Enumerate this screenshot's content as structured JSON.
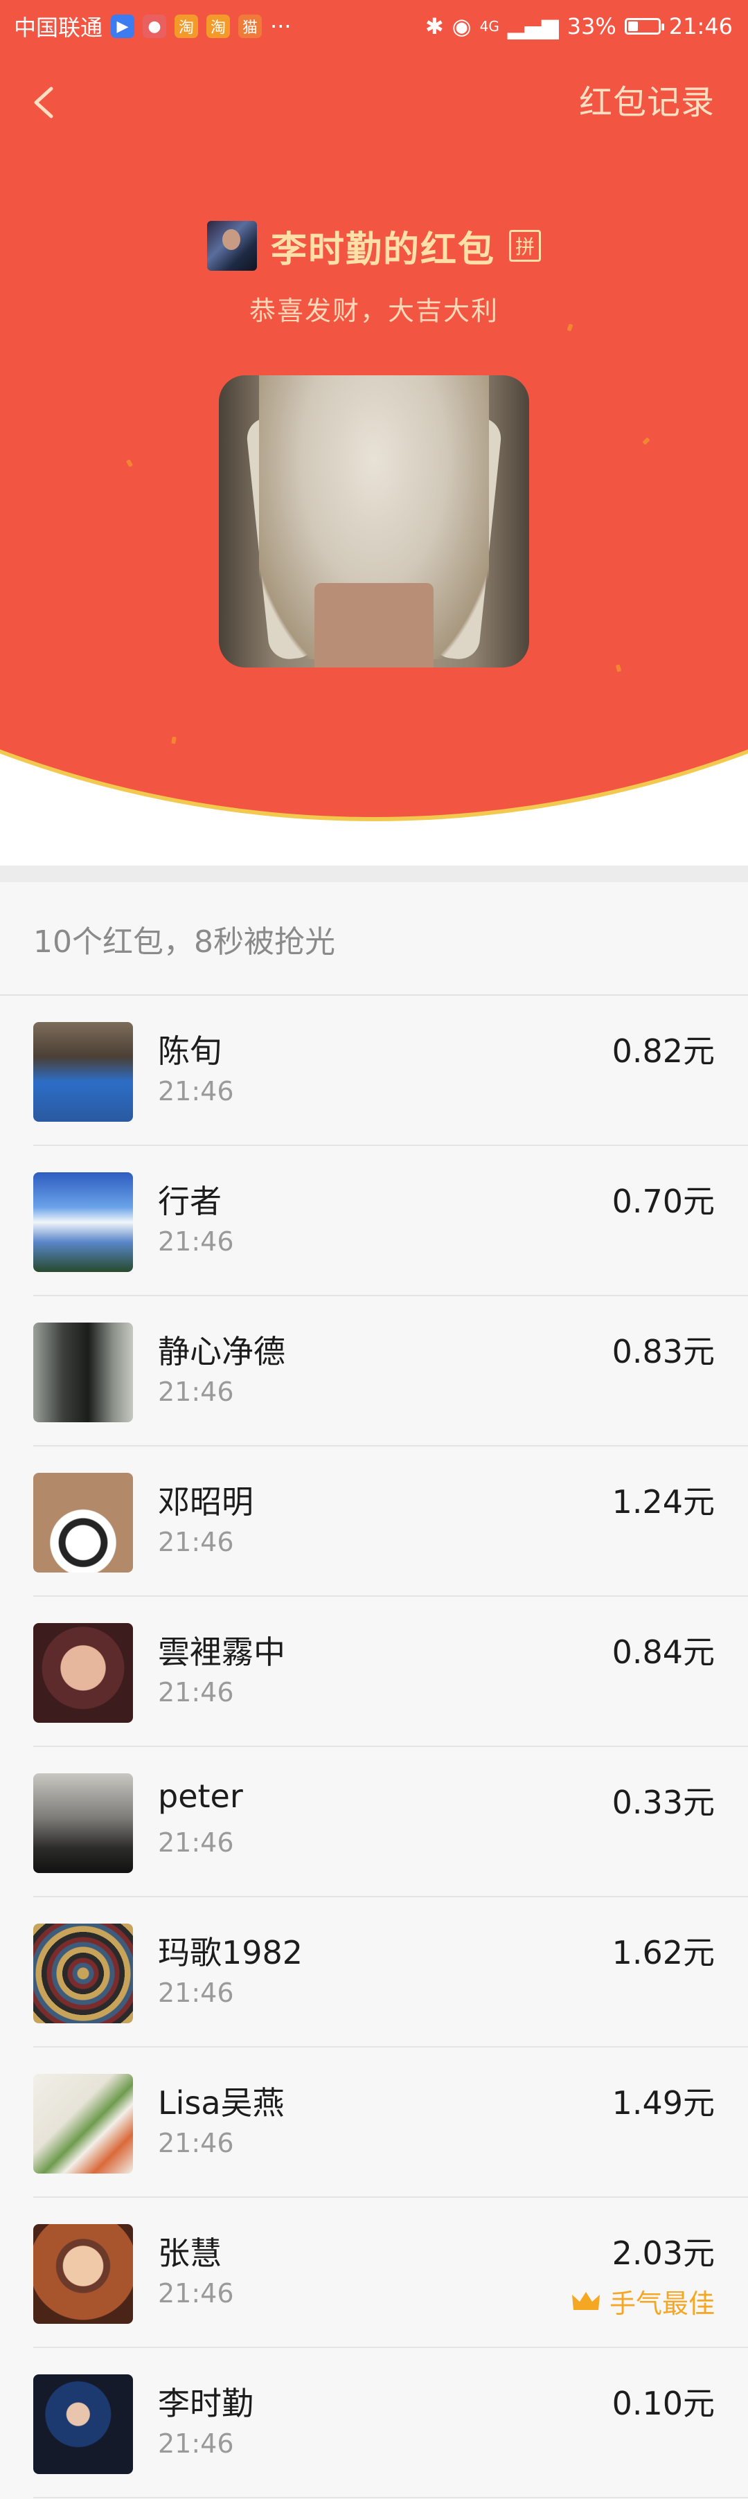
{
  "status_bar": {
    "carrier": "中国联通",
    "more": "···",
    "network": "4G",
    "battery": "33%",
    "time": "21:46"
  },
  "header": {
    "records_link": "红包记录",
    "sender_title": "李时勤的红包",
    "pin_badge": "拼",
    "greeting": "恭喜发财，大吉大利"
  },
  "summary": "10个红包，8秒被抢光",
  "list": [
    {
      "name": "陈旬",
      "time": "21:46",
      "amount": "0.82元"
    },
    {
      "name": "行者",
      "time": "21:46",
      "amount": "0.70元"
    },
    {
      "name": "静心净德",
      "time": "21:46",
      "amount": "0.83元"
    },
    {
      "name": "邓昭明",
      "time": "21:46",
      "amount": "1.24元"
    },
    {
      "name": "雲裡霧中",
      "time": "21:46",
      "amount": "0.84元"
    },
    {
      "name": "peter",
      "time": "21:46",
      "amount": "0.33元"
    },
    {
      "name": "玛歌1982",
      "time": "21:46",
      "amount": "1.62元"
    },
    {
      "name": "Lisa吴燕",
      "time": "21:46",
      "amount": "1.49元"
    },
    {
      "name": "张慧",
      "time": "21:46",
      "amount": "2.03元",
      "best": "手气最佳"
    },
    {
      "name": "李时勤",
      "time": "21:46",
      "amount": "0.10元"
    }
  ],
  "colors": {
    "header_red": "#f25643",
    "title_gold": "#ffe0a8",
    "best_luck": "#f5a623"
  }
}
